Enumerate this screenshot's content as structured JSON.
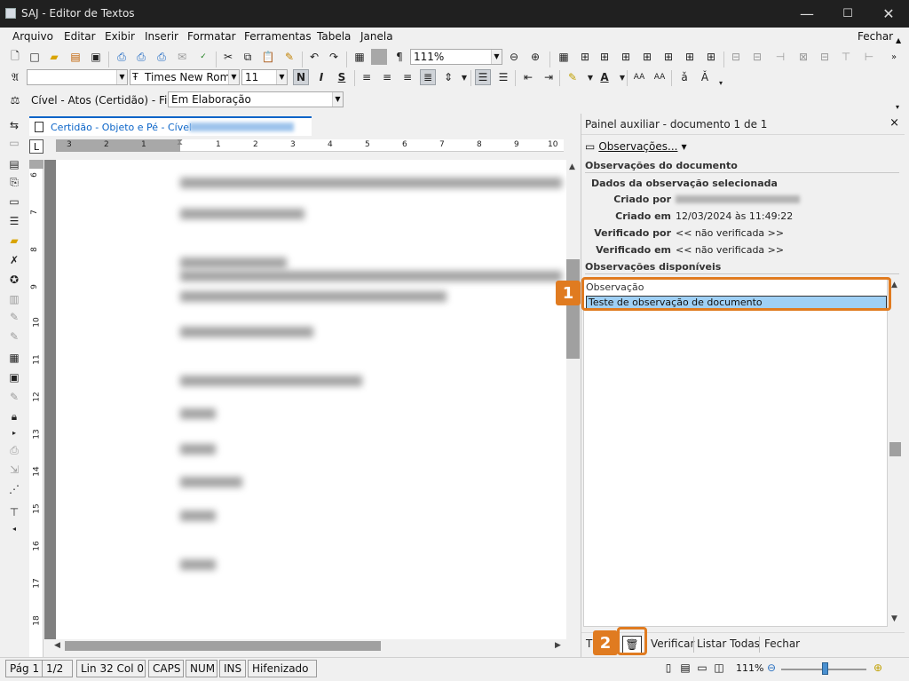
{
  "window": {
    "title": "SAJ - Editor de Textos",
    "minimize_glyph": "—",
    "maximize_glyph": "☐",
    "close_glyph": "✕"
  },
  "menu": {
    "items": [
      "Arquivo",
      "Editar",
      "Exibir",
      "Inserir",
      "Formatar",
      "Ferramentas",
      "Tabela",
      "Janela"
    ],
    "right_item": "Fechar"
  },
  "toolbar1": {
    "zoom_value": "111%"
  },
  "toolbar2": {
    "style_value": "",
    "font_value": "Times New Roman",
    "size_value": "11",
    "bold_label": "N",
    "italic_label": "I",
    "underline_label": "S"
  },
  "toolbar3": {
    "context_label": "Cível - Atos (Certidão) - Fila:",
    "queue_value": "Em Elaboração"
  },
  "document": {
    "tab_label": "Certidão - Objeto e Pé - Cível"
  },
  "ruler": {
    "h_numbers": [
      "3",
      "2",
      "1",
      "1",
      "2",
      "3",
      "4",
      "5",
      "6",
      "7",
      "8",
      "9",
      "10"
    ],
    "v_numbers": [
      "6",
      "7",
      "8",
      "9",
      "10",
      "11",
      "12",
      "13",
      "14",
      "15",
      "16",
      "17",
      "18"
    ]
  },
  "panel": {
    "title": "Painel auxiliar - documento 1 de 1",
    "close_glyph": "×",
    "observations_button": "Observações...",
    "section_doc_obs": "Observações do documento",
    "section_selected": "Dados da observação selecionada",
    "fields": {
      "created_by_label": "Criado por",
      "created_at_label": "Criado em",
      "created_at_value": "12/03/2024 às 11:49:22",
      "verified_by_label": "Verificado por",
      "verified_by_value": "<< não verificada >>",
      "verified_at_label": "Verificado em",
      "verified_at_value": "<< não verificada >>"
    },
    "section_available": "Observações disponíveis",
    "list_header": "Observação",
    "list_rows": [
      "Teste de observação de documento"
    ],
    "footer": {
      "first_button": "T",
      "verify_button": "Verificar",
      "list_all_button": "Listar Todas",
      "close_button": "Fechar"
    }
  },
  "annotations": {
    "badge1": "1",
    "badge2": "2",
    "color": "#e07b20"
  },
  "statusbar": {
    "page": "Pág 1",
    "page_of": "1/2",
    "position": "Lin 32  Col 0",
    "caps": "CAPS",
    "num": "NUM",
    "ins": "INS",
    "hyphen": "Hifenizado",
    "zoom": "111%"
  },
  "colors": {
    "accent": "#0a64c8",
    "selection": "#9fd0f5",
    "titlebar": "#202020"
  }
}
